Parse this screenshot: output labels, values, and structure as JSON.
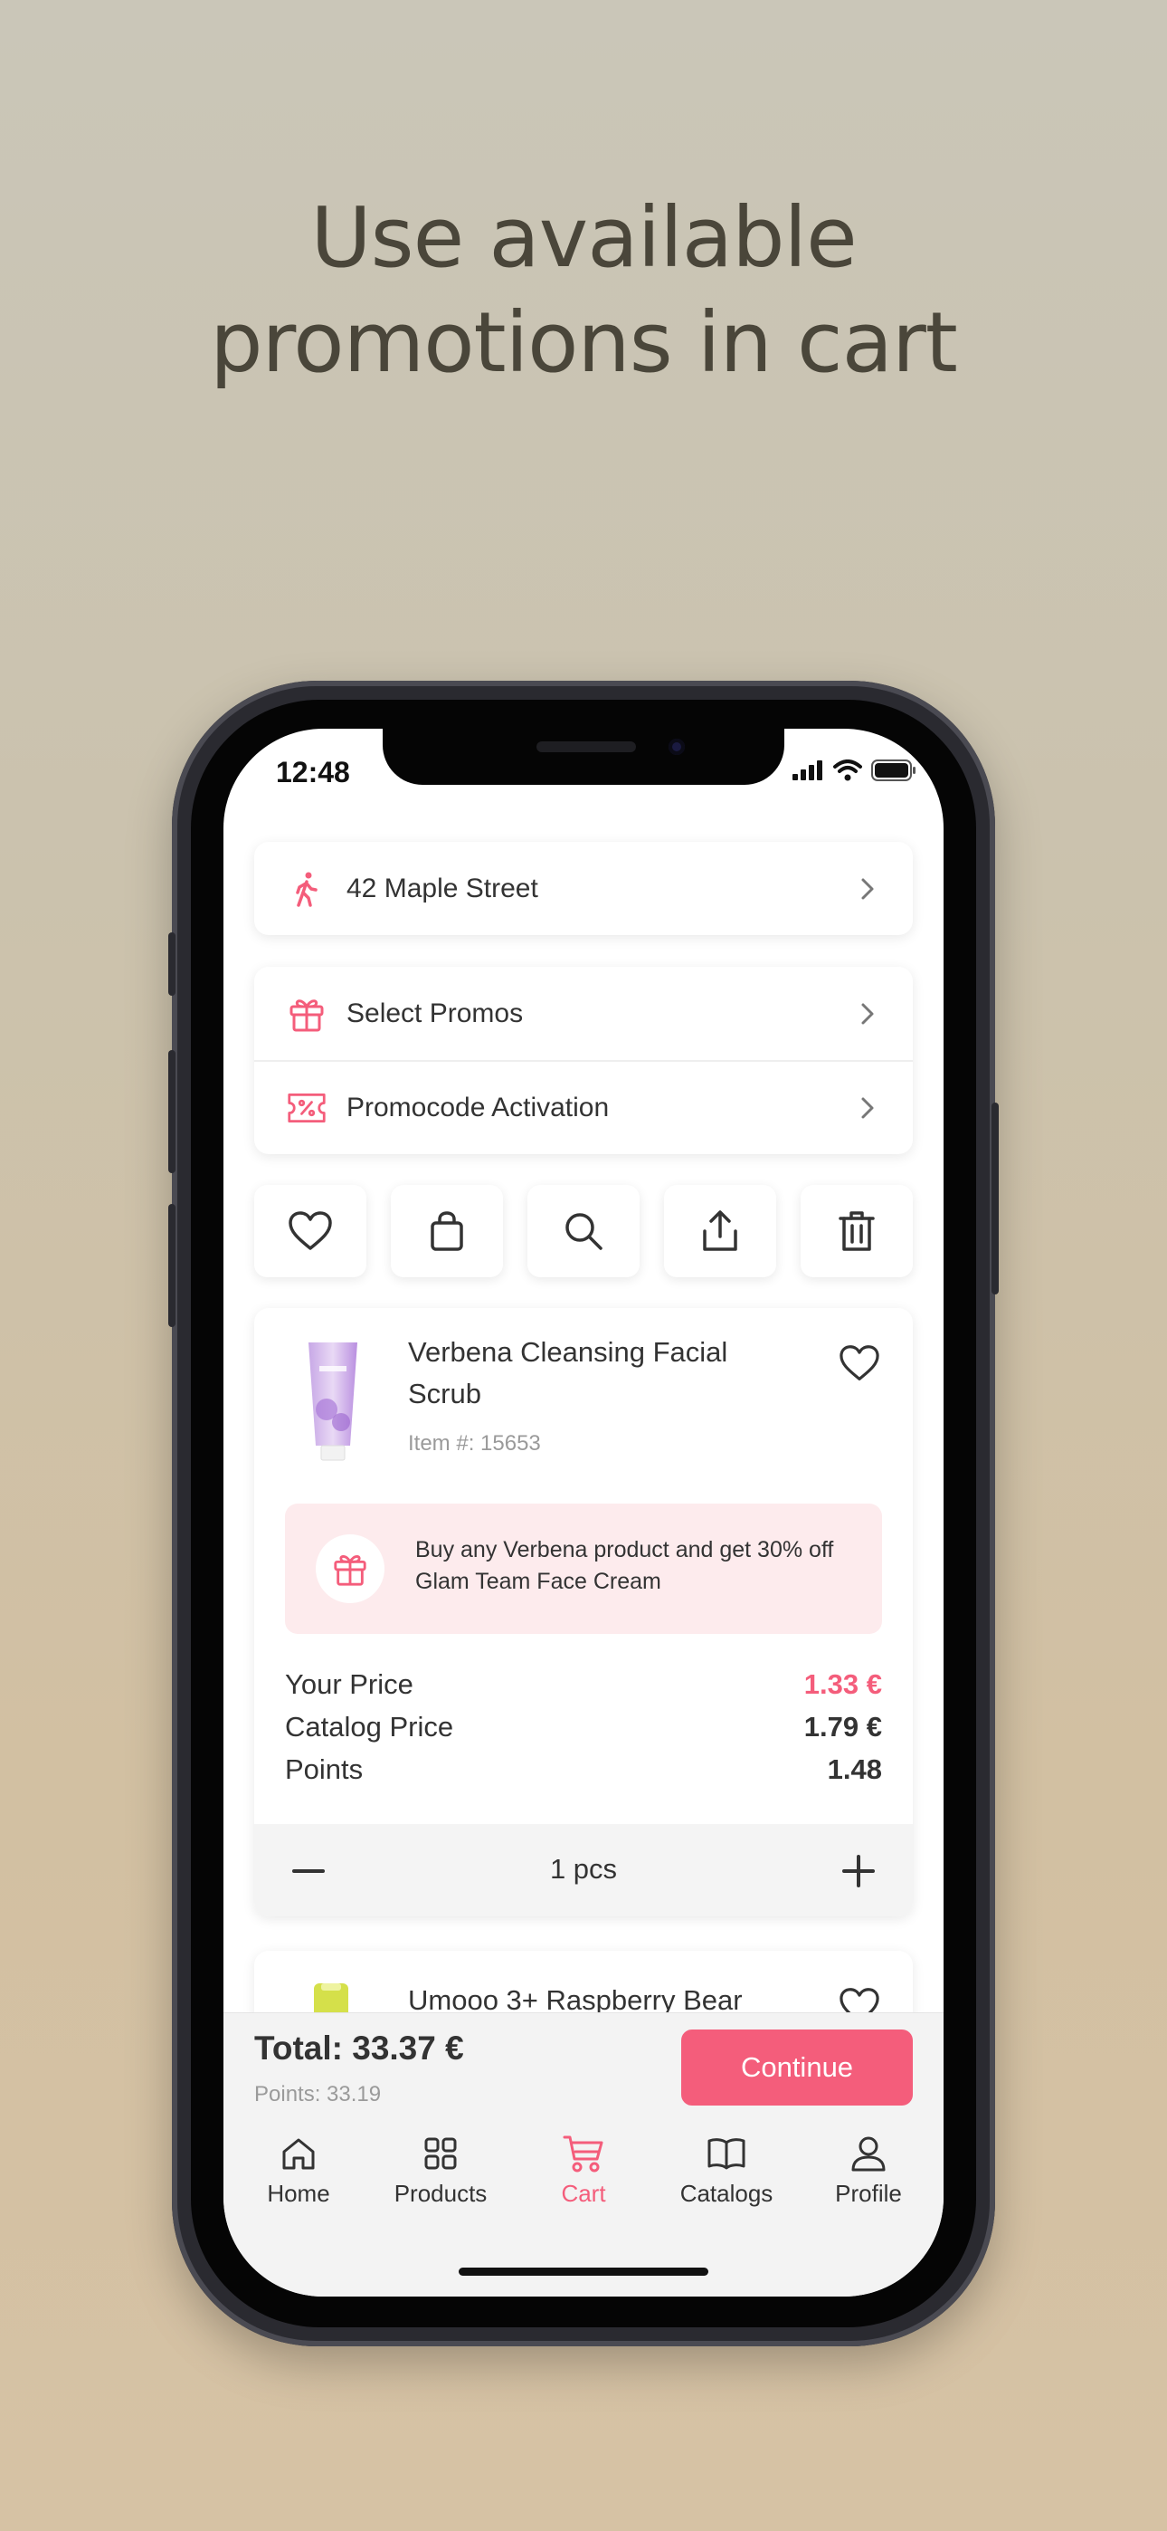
{
  "headline": {
    "line1": "Use available",
    "line2": "promotions in cart"
  },
  "status_bar": {
    "time": "12:48"
  },
  "address": {
    "label": "42 Maple Street"
  },
  "promos": {
    "select_label": "Select Promos",
    "promocode_label": "Promocode Activation"
  },
  "actions": [
    "heart-icon",
    "bag-icon",
    "search-icon",
    "share-icon",
    "trash-icon"
  ],
  "products": [
    {
      "name": "Verbena Cleansing Facial Scrub",
      "item_number": "Item #: 15653",
      "promo_text": "Buy any Verbena product and get 30% off Glam Team Face Cream",
      "your_price_label": "Your Price",
      "your_price": "1.33 €",
      "catalog_price_label": "Catalog Price",
      "catalog_price": "1.79 €",
      "points_label": "Points",
      "points": "1.48",
      "quantity": "1 pcs"
    },
    {
      "name": "Umooo 3+ Raspberry Bear"
    }
  ],
  "footer": {
    "total": "Total: 33.37 €",
    "points": "Points: 33.19",
    "continue_label": "Continue"
  },
  "tabs": [
    {
      "label": "Home",
      "icon": "home-icon",
      "active": false
    },
    {
      "label": "Products",
      "icon": "grid-icon",
      "active": false
    },
    {
      "label": "Cart",
      "icon": "cart-icon",
      "active": true
    },
    {
      "label": "Catalogs",
      "icon": "book-icon",
      "active": false
    },
    {
      "label": "Profile",
      "icon": "user-icon",
      "active": false
    }
  ],
  "colors": {
    "accent": "#f45d7b",
    "promo_bg": "#fdebed",
    "text": "#333333",
    "muted": "#9a9a9a"
  }
}
